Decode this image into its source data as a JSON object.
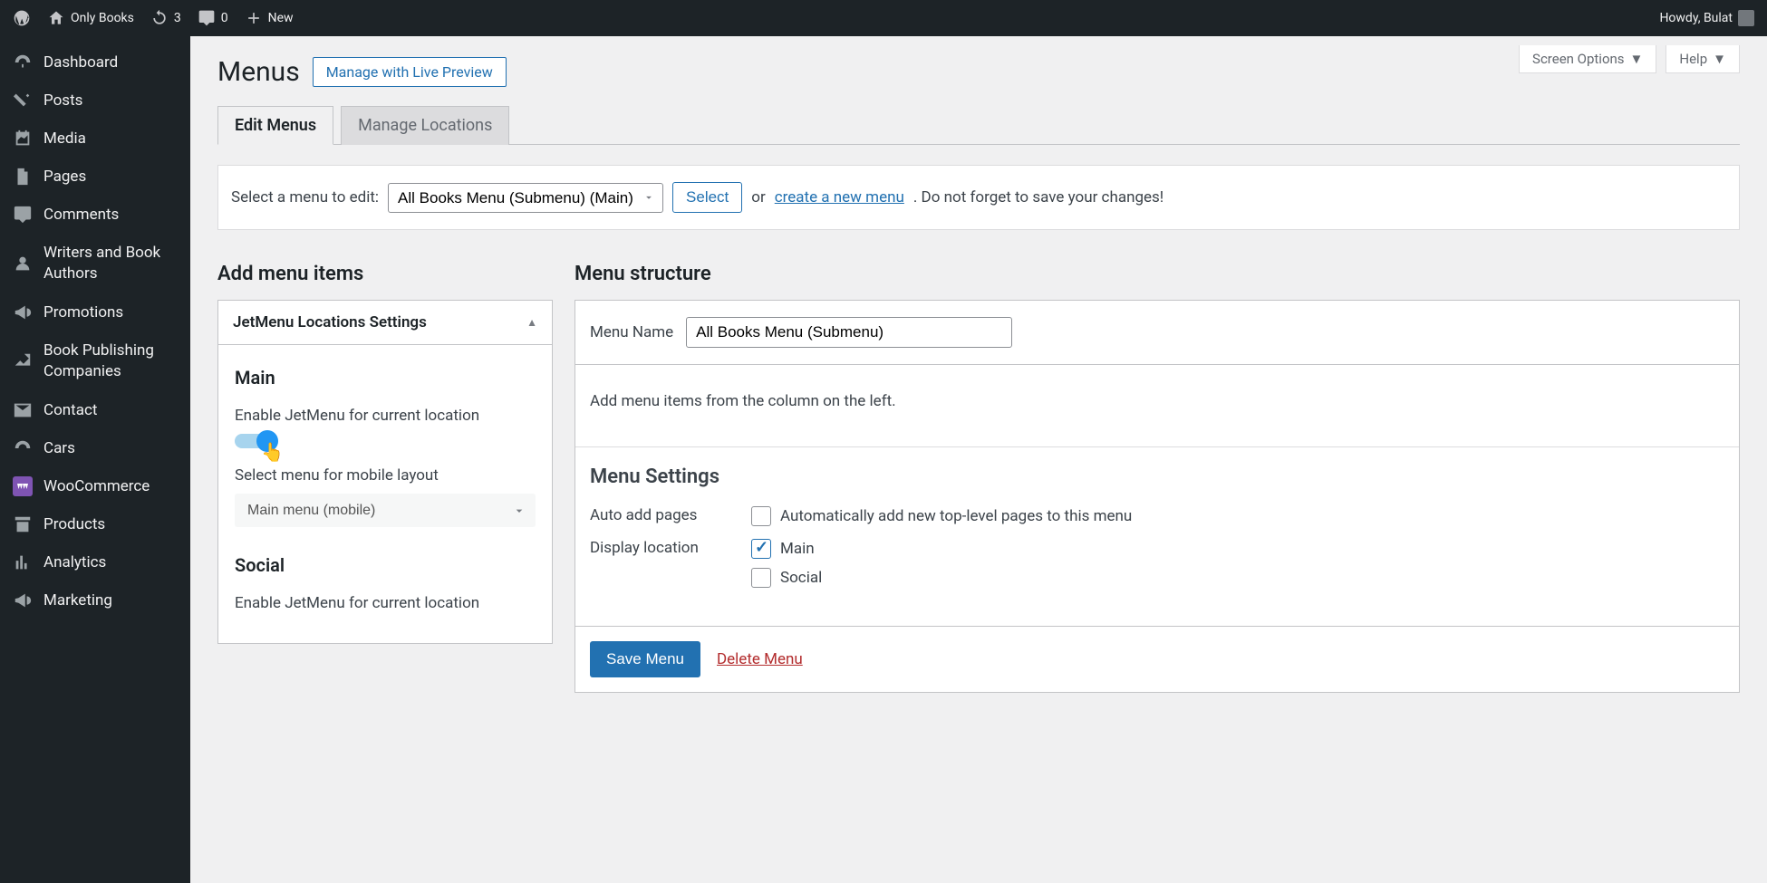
{
  "adminbar": {
    "site_name": "Only Books",
    "refresh_count": "3",
    "comments_count": "0",
    "new_label": "New",
    "howdy": "Howdy, Bulat"
  },
  "sidebar": {
    "items": [
      {
        "label": "Dashboard"
      },
      {
        "label": "Posts"
      },
      {
        "label": "Media"
      },
      {
        "label": "Pages"
      },
      {
        "label": "Comments"
      },
      {
        "label": "Writers and Book Authors"
      },
      {
        "label": "Promotions"
      },
      {
        "label": "Book Publishing Companies"
      },
      {
        "label": "Contact"
      },
      {
        "label": "Cars"
      },
      {
        "label": "WooCommerce"
      },
      {
        "label": "Products"
      },
      {
        "label": "Analytics"
      },
      {
        "label": "Marketing"
      }
    ]
  },
  "screen_meta": {
    "screen_options": "Screen Options",
    "help": "Help"
  },
  "page": {
    "title": "Menus",
    "live_preview": "Manage with Live Preview",
    "tabs": [
      "Edit Menus",
      "Manage Locations"
    ],
    "active_tab": 0
  },
  "menu_select_bar": {
    "label": "Select a menu to edit:",
    "selected": "All Books Menu (Submenu) (Main)",
    "select_btn": "Select",
    "or": "or",
    "create_link": "create a new menu",
    "reminder": ". Do not forget to save your changes!"
  },
  "left_col_title": "Add menu items",
  "jetmenu": {
    "panel_title": "JetMenu Locations Settings",
    "locations": [
      {
        "name": "Main",
        "enable_label": "Enable JetMenu for current location",
        "enabled": true,
        "mobile_label": "Select menu for mobile layout",
        "mobile_selected": "Main menu (mobile)"
      },
      {
        "name": "Social",
        "enable_label": "Enable JetMenu for current location"
      }
    ]
  },
  "right_col_title": "Menu structure",
  "menu_name_label": "Menu Name",
  "menu_name_value": "All Books Menu (Submenu)",
  "structure_hint": "Add menu items from the column on the left.",
  "menu_settings": {
    "heading": "Menu Settings",
    "auto_add_label": "Auto add pages",
    "auto_add_option": "Automatically add new top-level pages to this menu",
    "display_label": "Display location",
    "locations": [
      "Main",
      "Social"
    ],
    "checked_location": "Main"
  },
  "footer": {
    "save": "Save Menu",
    "delete": "Delete Menu"
  }
}
